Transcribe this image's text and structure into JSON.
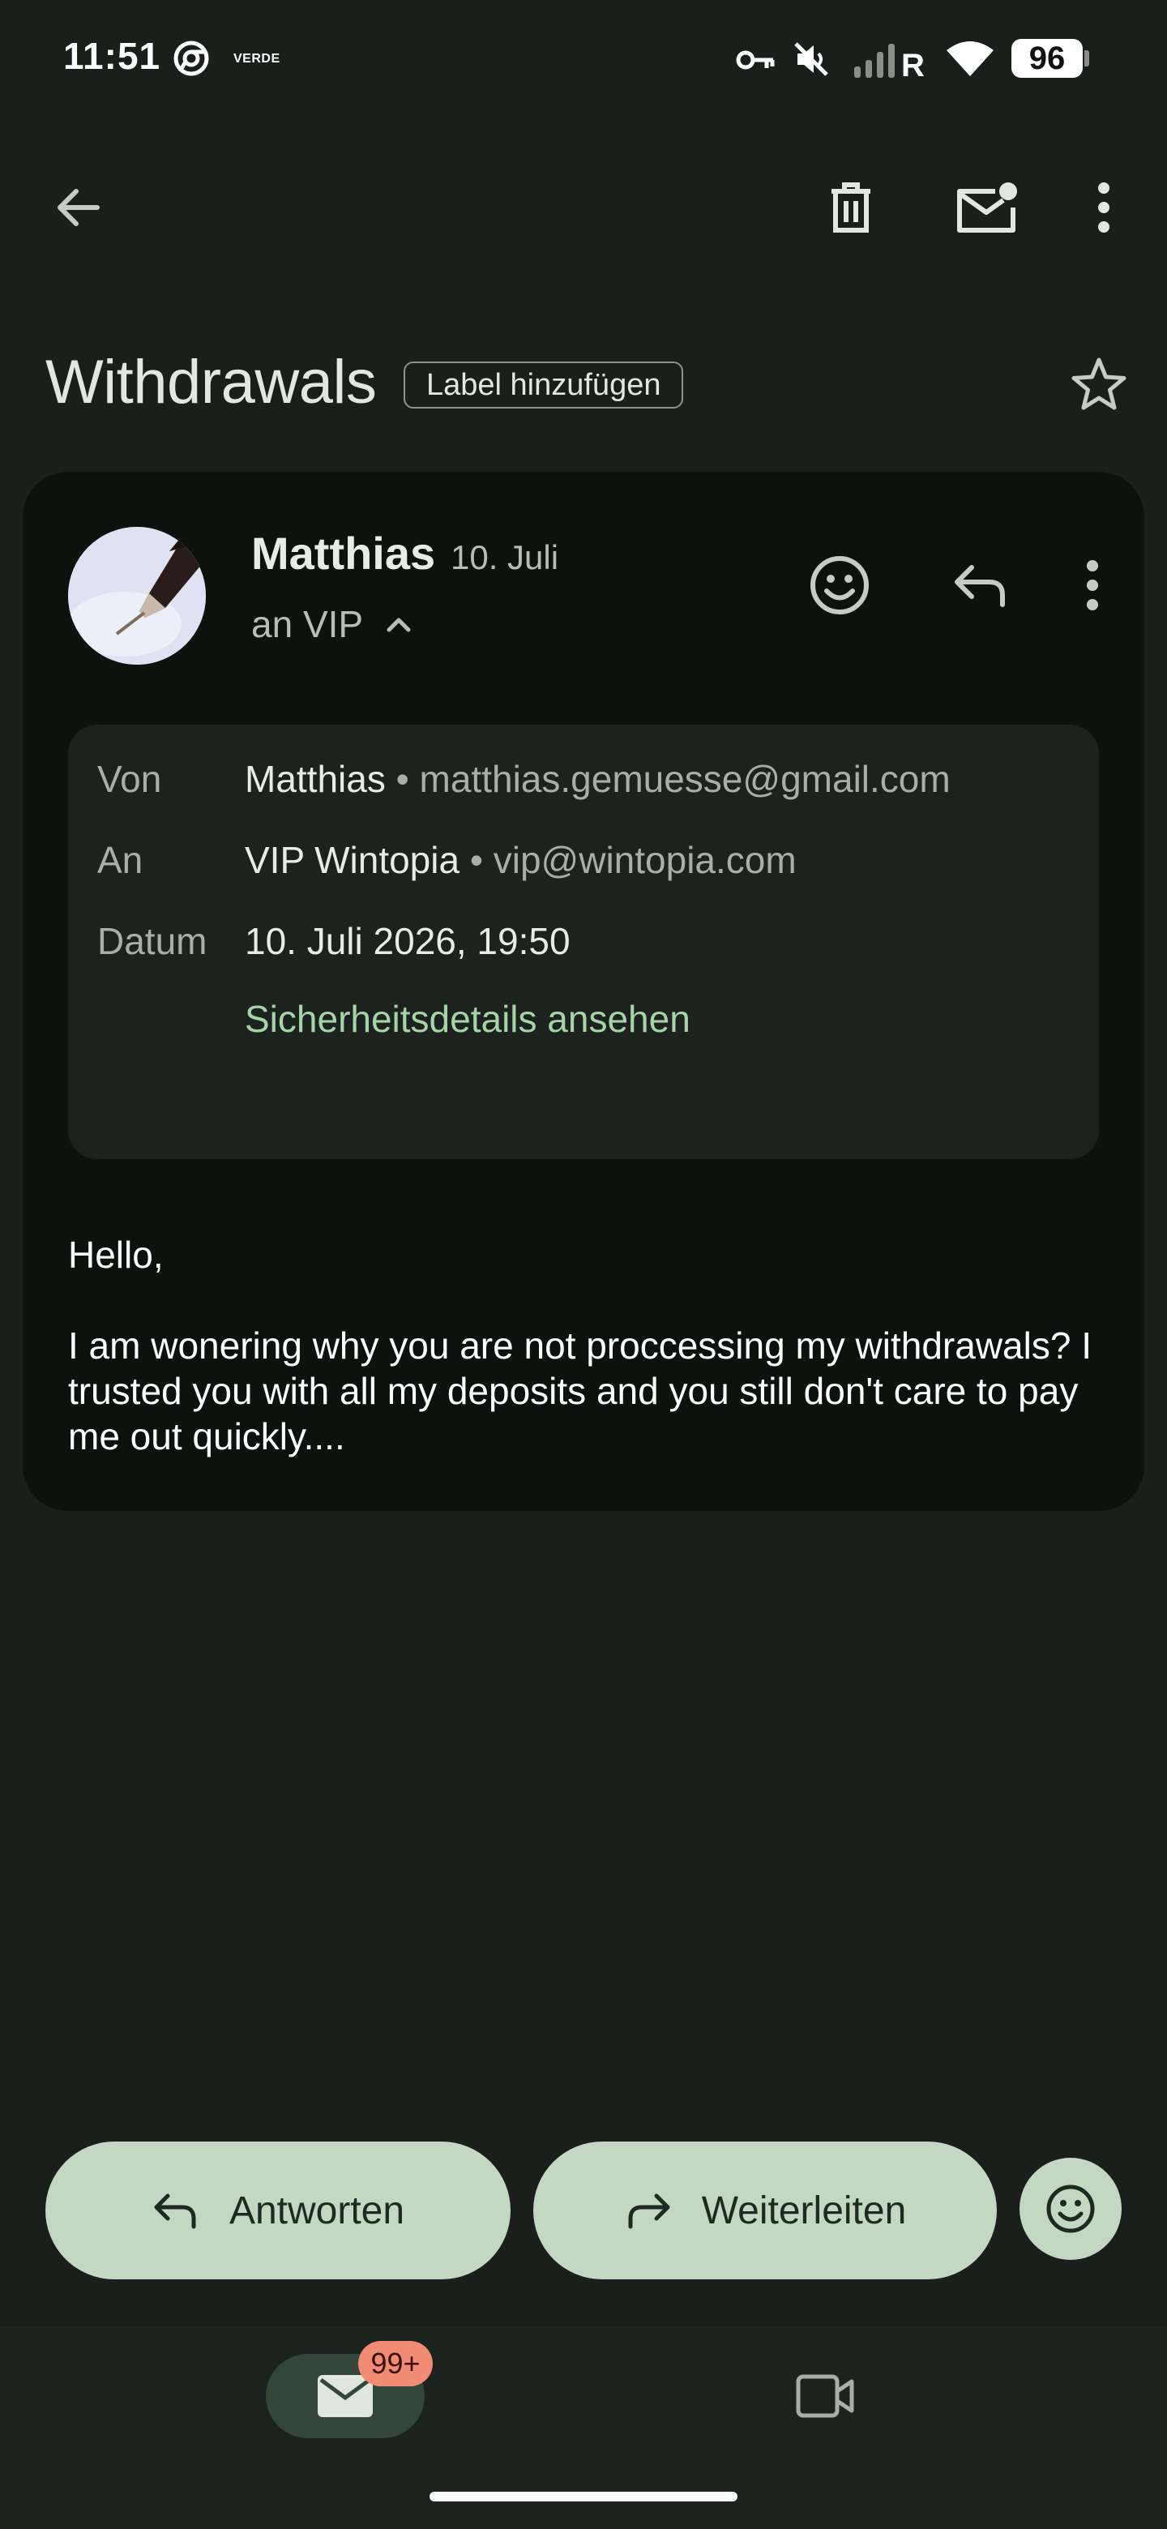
{
  "status_bar": {
    "time": "11:51",
    "carrier_badge": "VERDE",
    "battery": "96"
  },
  "toolbar": {
    "back_icon": "arrow-back-icon",
    "delete_icon": "trash-icon",
    "mark_unread_icon": "mark-unread-icon",
    "more_icon": "more-vert-icon"
  },
  "subject": {
    "title": "Withdrawals",
    "label_chip": "Label hinzufügen",
    "star_icon": "star-outline-icon"
  },
  "message": {
    "sender_name": "Matthias",
    "date": "10. Juli",
    "recipient_summary": "an VIP",
    "details": {
      "from_label": "Von",
      "from_name": "Matthias",
      "from_email": "matthias.gemuesse@gmail.com",
      "to_label": "An",
      "to_name": "VIP Wintopia",
      "to_email": "vip@wintopia.com",
      "date_label": "Datum",
      "date_value": "10. Juli 2026, 19:50",
      "security_link": "Sicherheitsdetails ansehen"
    },
    "body": {
      "greeting": "Hello,",
      "paragraph": "I am wonering why you are not proccessing my withdrawals? I trusted you with all my deposits and you still don't care to pay me out quickly...."
    }
  },
  "actions": {
    "reply": "Antworten",
    "forward": "Weiterleiten"
  },
  "bottom_nav": {
    "mail_badge": "99+"
  },
  "colors": {
    "background": "#1a1f1b",
    "card": "#0e120f",
    "details_panel": "#1c221e",
    "accent_link": "#a6d4a8",
    "pill_button": "#c4d7c3",
    "badge": "#f28b74"
  }
}
